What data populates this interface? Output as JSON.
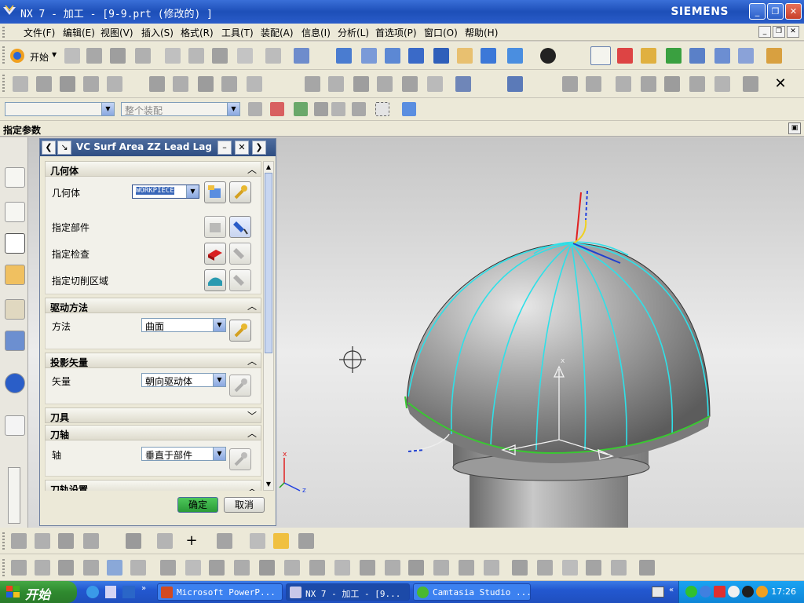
{
  "window": {
    "title": "NX 7 - 加工 - [9-9.prt  (修改的) ]",
    "brand": "SIEMENS",
    "controls": {
      "minimize": "_",
      "restore": "❐",
      "close": "✕"
    }
  },
  "menu": {
    "items": [
      "文件(F)",
      "编辑(E)",
      "视图(V)",
      "插入(S)",
      "格式(R)",
      "工具(T)",
      "装配(A)",
      "信息(I)",
      "分析(L)",
      "首选项(P)",
      "窗口(O)",
      "帮助(H)"
    ]
  },
  "toolbar": {
    "start_label": "开始",
    "selection_filter_placeholder": "",
    "assembly_scope": "整个装配"
  },
  "params_bar": {
    "label": "指定参数"
  },
  "dialog": {
    "title": "VC Surf Area ZZ Lead Lag",
    "sections": {
      "geometry": {
        "header": "几何体",
        "geometry_label": "几何体",
        "geometry_value": "WORKPIECE",
        "part_label": "指定部件",
        "check_label": "指定检查",
        "cut_area_label": "指定切削区域"
      },
      "drive": {
        "header": "驱动方法",
        "method_label": "方法",
        "method_value": "曲面"
      },
      "projection": {
        "header": "投影矢量",
        "vector_label": "矢量",
        "vector_value": "朝向驱动体"
      },
      "tool": {
        "header": "刀具"
      },
      "axis": {
        "header": "刀轴",
        "axis_label": "轴",
        "axis_value": "垂直于部件"
      },
      "axis_settings": {
        "header": "刀轨设置"
      }
    },
    "ok_label": "确定",
    "cancel_label": "取消"
  },
  "viewport": {
    "triad_x": "x",
    "triad_z": "z",
    "csys_label": "x"
  },
  "taskbar": {
    "start_label": "开始",
    "tasks": [
      {
        "label": "Microsoft PowerP...",
        "active": false
      },
      {
        "label": "NX 7 - 加工 - [9...",
        "active": true
      },
      {
        "label": "Camtasia Studio ...",
        "active": false
      }
    ],
    "clock": "17:26"
  },
  "colors": {
    "title_bar": "#1d4fb8",
    "dialog_title": "#2f4e82",
    "toolpath_cyan": "#2fe0e8",
    "boundary_green": "#3ac832",
    "model_gray": "#8c8c8c",
    "taskbar_blue": "#2358d0",
    "start_green": "#2f8a2f"
  }
}
